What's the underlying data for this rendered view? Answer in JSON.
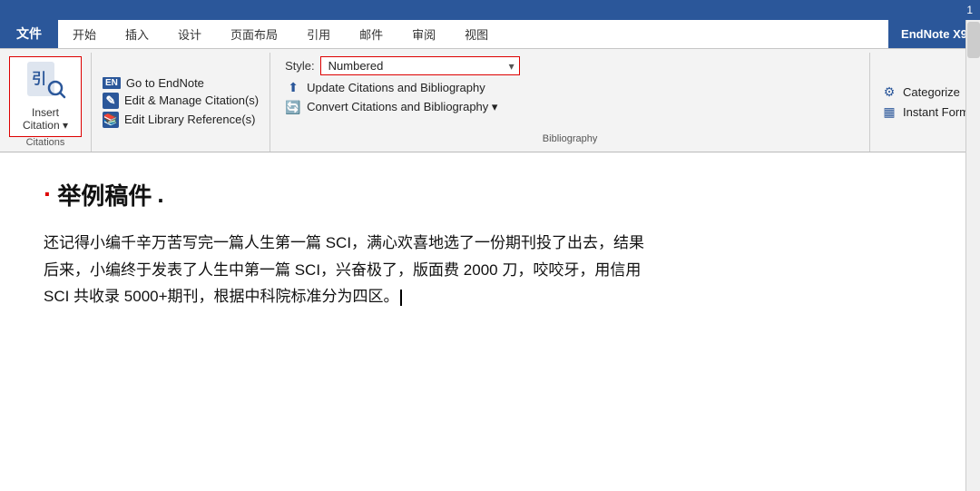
{
  "titlebar": {
    "page_number": "1"
  },
  "tabs": [
    {
      "label": "文件",
      "type": "file"
    },
    {
      "label": "开始",
      "type": "normal"
    },
    {
      "label": "插入",
      "type": "normal"
    },
    {
      "label": "设计",
      "type": "normal"
    },
    {
      "label": "页面布局",
      "type": "normal"
    },
    {
      "label": "引用",
      "type": "normal"
    },
    {
      "label": "邮件",
      "type": "normal"
    },
    {
      "label": "审阅",
      "type": "normal"
    },
    {
      "label": "视图",
      "type": "normal"
    },
    {
      "label": "EndNote X9",
      "type": "endnote"
    }
  ],
  "ribbon": {
    "insert_citation": {
      "icon": "🔍",
      "label_line1": "Insert",
      "label_line2": "Citation",
      "dropdown": "▾"
    },
    "citations_section_label": "Citations",
    "citations_items": [
      {
        "badge": "EN",
        "text": "Go to EndNote"
      },
      {
        "badge": "✎",
        "text": "Edit & Manage Citation(s)"
      },
      {
        "badge": "📚",
        "text": "Edit Library Reference(s)"
      }
    ],
    "bibliography_section_label": "Bibliography",
    "style_label": "Style:",
    "style_value": "Numbered",
    "style_placeholder": "Numbered",
    "bib_items": [
      {
        "icon": "⬆",
        "text": "Update Citations and Bibliography"
      },
      {
        "icon": "🔄",
        "text": "Convert Citations and Bibliography ▾"
      }
    ],
    "extra_items": [
      {
        "icon": "⚙",
        "text": "Categorize"
      },
      {
        "icon": "▦",
        "text": "Instant Form"
      }
    ]
  },
  "document": {
    "heading_bullet": "·",
    "heading_text": "举例稿件",
    "heading_suffix": ".",
    "paragraphs": [
      "还记得小编千辛万苦写完一篇人生第一篇 SCI，满心欢喜地选了一份期刊投了出去，结果",
      "后来，小编终于发表了人生中第一篇 SCI，兴奋极了，版面费 2000 刀，咬咬牙，用信用",
      "SCI 共收录 5000+期刊，根据中科院标准分为四区。|"
    ]
  }
}
